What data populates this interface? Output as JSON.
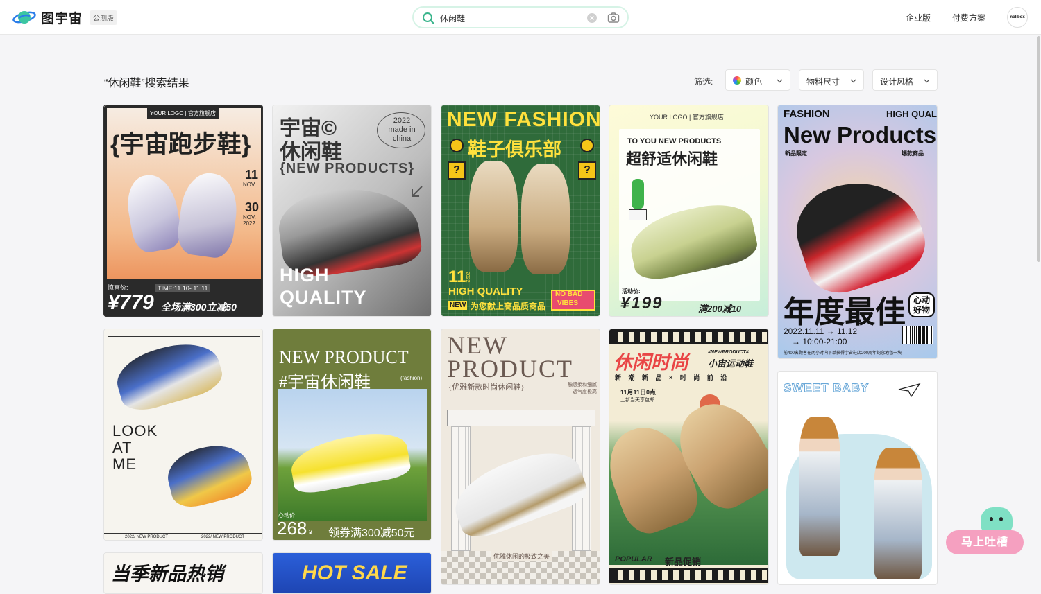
{
  "header": {
    "logo_text": "图宇宙",
    "beta_badge": "公测版",
    "search_value": "休闲鞋",
    "nav_enterprise": "企业版",
    "nav_pricing": "付费方案",
    "avatar_text": "nolibox"
  },
  "toolbar": {
    "results_title": "“休闲鞋”搜索结果",
    "filter_label": "筛选:",
    "filters": [
      "颜色",
      "物料尺寸",
      "设计风格"
    ]
  },
  "cards": {
    "c1": {
      "brand": "YOUR LOGO | 官方旗舰店",
      "title": "{宇宙跑步鞋}",
      "d1": "11",
      "m1": "NOV.",
      "d2": "30",
      "m2": "NOV.",
      "y2": "2022",
      "price_label": "惊喜价:",
      "time": "TIME:11.10- 11.11",
      "price": "¥779",
      "promo": "全场满300立减50"
    },
    "c2": {
      "title1": "宇宙©",
      "title2": "休闲鞋",
      "title3": "{NEW PRODUCTS}",
      "badge": "2022 made in china",
      "high": "HIGH",
      "quality": "QUALITY"
    },
    "c3": {
      "title": "NEW FASHION",
      "sub": "鞋子俱乐部",
      "num": "11",
      "year": "2022",
      "hq": "HIGH QUALITY",
      "new": "NEW",
      "slogan": "为您献上高品质商品",
      "badge1": "NO BAD",
      "badge2": "VIBES"
    },
    "c4": {
      "brand": "YOUR LOGO | 官方旗舰店",
      "eng": "TO YOU NEW PRODUCTS",
      "title": "超舒适休闲鞋",
      "price_label": "活动价:",
      "price": "¥199",
      "promo": "满200减10"
    },
    "c5": {
      "fashion": "FASHION",
      "hq": "HIGH QUALITY",
      "title": "New Products",
      "l1": "新品限定",
      "l2": "爆款商品",
      "big": "年度最佳",
      "badge": "心动好物",
      "date": "2022.11.11 → 11.12",
      "time": "→ 10:00-21:00",
      "foot": "前400名顾客在两小时内下单获得宇宙鞋店200周年纪念地毯一块"
    },
    "c6": {
      "text1": "LOOK",
      "text2": "AT",
      "text3": "ME",
      "foot1": "2022/ NEW PRODUCT",
      "foot2": "2022/ NEW PRODUCT"
    },
    "c7": {
      "title": "NEW PRODUCT",
      "sub": "#宇宙休闲鞋",
      "tag": "(fashion)",
      "label": "心动价",
      "price": "268",
      "currency": "¥",
      "promo": "领券满300减50元"
    },
    "c8": {
      "title1": "NEW",
      "title2": "PRODUCT",
      "sub": "{优雅新款时尚休闲鞋}",
      "side": "触感柔和细腻 透气度极高",
      "foot": "优雅休闲的极致之美"
    },
    "c9": {
      "title": "休闲时尚",
      "tag": "#NEWPRODUCT#",
      "sub": "小宙运动鞋",
      "row": "新 潮 新 品 × 时 尚 前 沿",
      "date": "11月11日0点",
      "date2": "上新当天享包邮",
      "popular": "POPULAR",
      "promo": "新品促销"
    },
    "c10": {
      "title": "SWEET BABY"
    },
    "c11": {
      "title": "当季新品热销"
    },
    "c12": {
      "title": "HOT SALE"
    }
  },
  "feedback": {
    "label": "马上吐槽"
  }
}
